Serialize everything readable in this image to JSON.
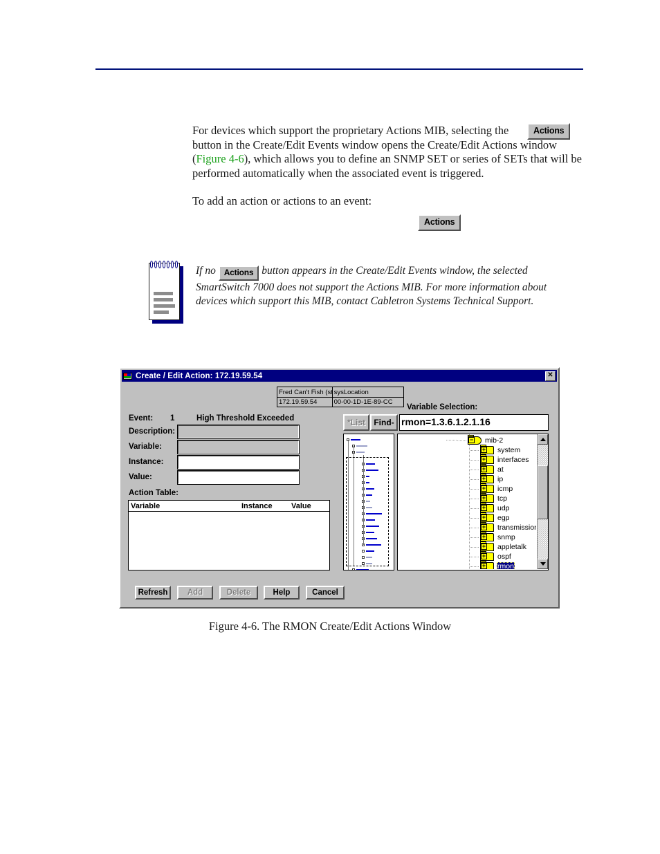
{
  "document": {
    "paragraph_1_parts": {
      "before": "For devices which support the proprietary Actions MIB, selecting the ",
      "after_button": " button in the Create/Edit Events window opens the Create/Edit Actions window (",
      "figure_link": "Figure 4-6",
      "tail": "), which allows you to define an SNMP SET or series of SETs that will be performed automatically when the associated event is triggered."
    },
    "paragraph_2": "To add an action or actions to an event:",
    "actions_button_label": "Actions",
    "note": {
      "before": "If no ",
      "button_label": "Actions",
      "after": " button appears in the Create/Edit Events window, the selected SmartSwitch 7000 does not support the Actions MIB. For more information about devices which support this MIB, contact Cabletron Systems Technical Support."
    },
    "figure_caption": "Figure 4-6.  The RMON Create/Edit Actions Window",
    "link_color": "#1aa01a",
    "rule_color": "#00117a"
  },
  "dialog": {
    "title": "Create / Edit Action: 172.19.59.54",
    "title_bar_color": "#000080",
    "face_color": "#c0c0c0",
    "close_label": "✕",
    "info_table": {
      "headers": [
        "Fred Can't Fish (sti",
        "sysLocation"
      ],
      "values": [
        "172.19.59.54",
        "00-00-1D-1E-89-CC"
      ]
    },
    "form": {
      "event_label": "Event:",
      "event_number": "1",
      "event_name": "High Threshold Exceeded",
      "description_label": "Description:",
      "description_value": "",
      "variable_label": "Variable:",
      "variable_value": "",
      "instance_label": "Instance:",
      "instance_value": "",
      "value_label": "Value:",
      "value_value": "",
      "action_table_label": "Action Table:"
    },
    "action_table": {
      "columns": [
        "Variable",
        "Instance",
        "Value"
      ],
      "rows": []
    },
    "buttons": [
      {
        "name": "refresh",
        "label": "Refresh",
        "enabled": true
      },
      {
        "name": "add",
        "label": "Add",
        "enabled": false
      },
      {
        "name": "delete",
        "label": "Delete",
        "enabled": false
      },
      {
        "name": "help",
        "label": "Help",
        "enabled": true
      },
      {
        "name": "cancel",
        "label": "Cancel",
        "enabled": true
      }
    ],
    "variable_selection": {
      "label": "Variable Selection:",
      "list_button": "*List",
      "find_button": "Find->",
      "input_value": "rmon=1.3.6.1.2.1.16"
    },
    "mib_tree": {
      "root": {
        "label": "mib-2",
        "state": "minus"
      },
      "children": [
        {
          "label": "system",
          "state": "plus",
          "selected": false
        },
        {
          "label": "interfaces",
          "state": "plus",
          "selected": false
        },
        {
          "label": "at",
          "state": "plus",
          "selected": false
        },
        {
          "label": "ip",
          "state": "plus",
          "selected": false
        },
        {
          "label": "icmp",
          "state": "plus",
          "selected": false
        },
        {
          "label": "tcp",
          "state": "plus",
          "selected": false
        },
        {
          "label": "udp",
          "state": "plus",
          "selected": false
        },
        {
          "label": "egp",
          "state": "plus",
          "selected": false
        },
        {
          "label": "transmission",
          "state": "plus",
          "selected": false
        },
        {
          "label": "snmp",
          "state": "plus",
          "selected": false
        },
        {
          "label": "appletalk",
          "state": "plus",
          "selected": false
        },
        {
          "label": "ospf",
          "state": "plus",
          "selected": false
        },
        {
          "label": "rmon",
          "state": "plus",
          "selected": true
        }
      ],
      "selected_node": "rmon",
      "folder_color": "#ffff00",
      "selection_color": "#000080"
    }
  }
}
